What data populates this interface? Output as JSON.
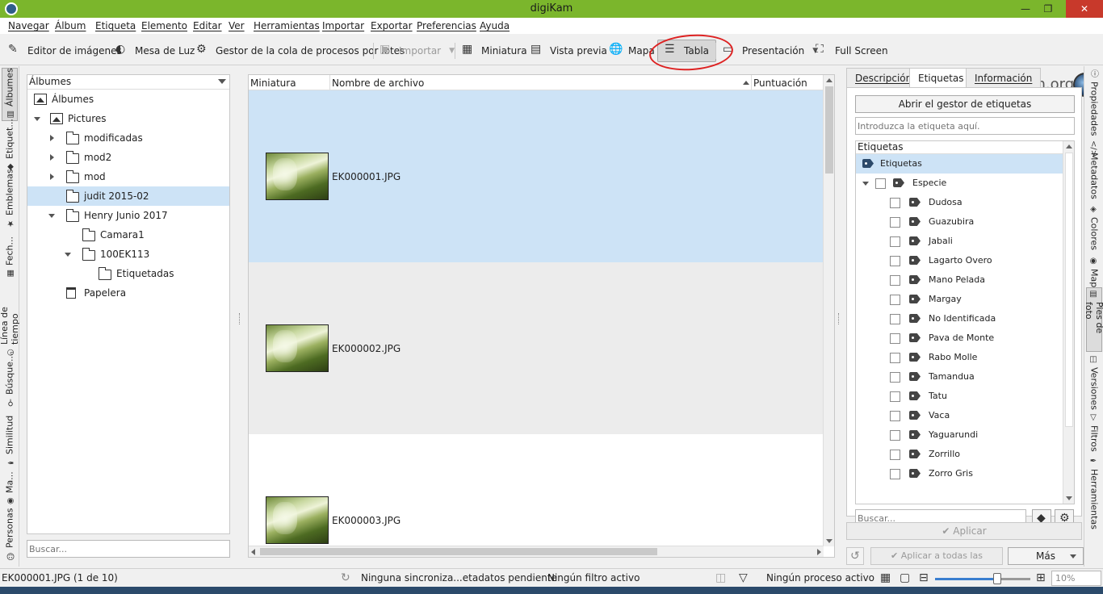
{
  "window": {
    "title": "digiKam",
    "min": "—",
    "max": "❐",
    "close": "✕"
  },
  "menu": [
    "Navegar",
    "Álbum",
    "Etiqueta",
    "Elemento",
    "Editar",
    "Ver",
    "Herramientas",
    "Importar",
    "Exportar",
    "Preferencias",
    "Ayuda"
  ],
  "toolbar": {
    "image_editor": "Editor de imágenes",
    "light_table": "Mesa de Luz",
    "batch_queue": "Gestor de la cola de procesos por lotes",
    "import": "Importar",
    "thumbnails": "Miniatura",
    "preview": "Vista previa",
    "map": "Mapa",
    "table": "Tabla",
    "presentation": "Presentación",
    "fullscreen": "Full Screen",
    "brand": "digiKam.org"
  },
  "left_tabs": [
    "Álbumes",
    "Etiquet...",
    "Emblemas",
    "Fech...",
    "Línea de tiempo",
    "Búsque...",
    "Similitud",
    "Ma...",
    "Personas"
  ],
  "albums": {
    "header": "Álbumes",
    "search_placeholder": "Buscar...",
    "items": [
      {
        "label": "Álbumes"
      },
      {
        "label": "Pictures"
      },
      {
        "label": "modificadas"
      },
      {
        "label": "mod2"
      },
      {
        "label": "mod"
      },
      {
        "label": "judit 2015-02"
      },
      {
        "label": "Henry Junio 2017"
      },
      {
        "label": "Camara1"
      },
      {
        "label": "100EK113"
      },
      {
        "label": "Etiquetadas"
      },
      {
        "label": "Papelera"
      }
    ]
  },
  "table": {
    "columns": [
      "Miniatura",
      "Nombre de archivo",
      "Puntuación"
    ],
    "rows": [
      {
        "filename": "EK000001.JPG"
      },
      {
        "filename": "EK000002.JPG"
      },
      {
        "filename": "EK000003.JPG"
      }
    ]
  },
  "right_panel": {
    "tabs": [
      "Descripción",
      "Etiquetas",
      "Información"
    ],
    "open_tag_manager": "Abrir el gestor de etiquetas",
    "tag_input_placeholder": "Introduzca la etiqueta aquí.",
    "tree_header": "Etiquetas",
    "root": "Etiquetas",
    "group": "Especie",
    "tags": [
      "Dudosa",
      "Guazubira",
      "Jabali",
      "Lagarto Overo",
      "Mano Pelada",
      "Margay",
      "No Identificada",
      "Pava de Monte",
      "Rabo Molle",
      "Tamandua",
      "Tatu",
      "Vaca",
      "Yaguarundi",
      "Zorrillo",
      "Zorro Gris"
    ],
    "search_placeholder": "Buscar...",
    "apply": "✔ Aplicar",
    "apply_all": "✔ Aplicar a todas las versiones",
    "more": "Más"
  },
  "right_tabs": [
    "Propiedades",
    "Metadatos",
    "Colores",
    "Mapa",
    "Pies de foto",
    "Versiones",
    "Filtros",
    "Herramientas"
  ],
  "status": {
    "selection": "EK000001.JPG (1 de 10)",
    "sync": "Ninguna sincroniza...etadatos pendiente",
    "filter": "Ningún filtro activo",
    "process": "Ningún proceso activo",
    "zoom": "10%",
    "zoom_level": 0.65
  },
  "colors": {
    "titlebar": "#7bb62c",
    "selection": "#cde3f6",
    "close": "#c8392b"
  }
}
